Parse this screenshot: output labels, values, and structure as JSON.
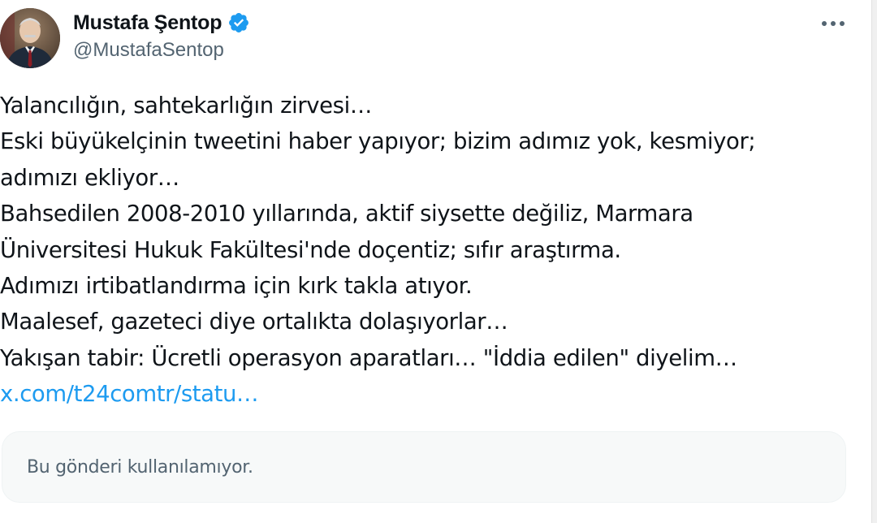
{
  "author": {
    "name": "Mustafa Şentop",
    "handle": "@MustafaSentop",
    "verified": true,
    "avatar_icon": "profile-photo"
  },
  "menu_icon": "more-horizontal-icon",
  "tweet": {
    "lines": [
      "Yalancılığın, sahtekarlığın zirvesi…",
      "Eski büyükelçinin tweetini haber yapıyor; bizim adımız yok, kesmiyor;",
      "adımızı ekliyor…",
      "Bahsedilen 2008-2010 yıllarında, aktif siysette değiliz, Marmara",
      "Üniversitesi Hukuk Fakültesi'nde doçentiz; sıfır araştırma.",
      "Adımızı irtibatlandırma için kırk takla atıyor.",
      "Maalesef, gazeteci diye ortalıkta dolaşıyorlar…",
      "Yakışan tabir: Ücretli operasyon aparatları… \"İddia edilen\" diyelim…"
    ],
    "link_text": "x.com/t24comtr/statu…"
  },
  "quoted_post": {
    "unavailable_text": "Bu gönderi kullanılamıyor."
  },
  "colors": {
    "link": "#1d9bf0",
    "verified": "#1d9bf0",
    "secondary_text": "#536471",
    "primary_text": "#0f1419",
    "card_background": "#f7f9f9"
  }
}
